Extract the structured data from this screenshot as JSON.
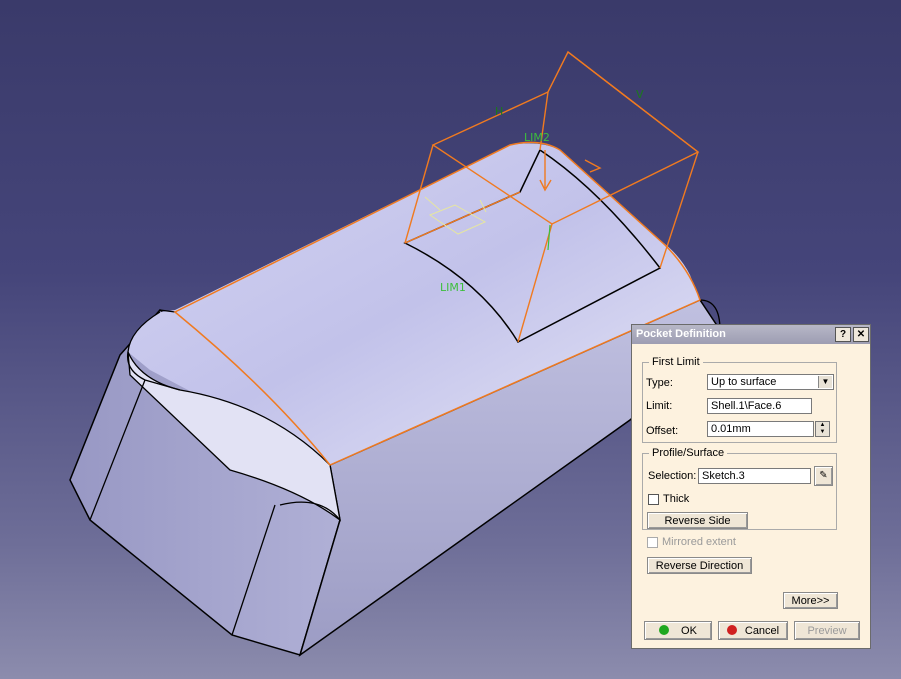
{
  "viewport": {
    "labels": {
      "h": "H",
      "v": "V",
      "lim1": "LIM1",
      "lim2": "LIM2"
    }
  },
  "dialog": {
    "title": "Pocket Definition",
    "help": "?",
    "close": "✕",
    "first_limit": {
      "legend": "First Limit",
      "type_label": "Type:",
      "type_value": "Up to surface",
      "limit_label": "Limit:",
      "limit_value": "Shell.1\\Face.6",
      "offset_label": "Offset:",
      "offset_value": "0.01mm"
    },
    "profile": {
      "legend": "Profile/Surface",
      "selection_label": "Selection:",
      "selection_value": "Sketch.3",
      "thick_label": "Thick",
      "reverse_side": "Reverse Side"
    },
    "mirrored_extent": "Mirrored extent",
    "reverse_direction": "Reverse Direction",
    "more": "More>>",
    "ok": "OK",
    "cancel": "Cancel",
    "preview": "Preview"
  }
}
